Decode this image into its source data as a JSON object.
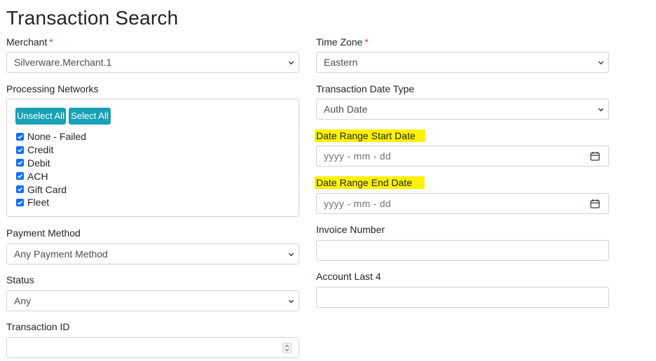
{
  "page": {
    "title": "Transaction Search"
  },
  "left": {
    "merchant": {
      "label": "Merchant",
      "required_mark": "*",
      "value": "Silverware.Merchant.1"
    },
    "processing_networks": {
      "label": "Processing Networks",
      "unselect_all": "Unselect All",
      "select_all": "Select All",
      "items": [
        {
          "label": "None - Failed",
          "checked": true
        },
        {
          "label": "Credit",
          "checked": true
        },
        {
          "label": "Debit",
          "checked": true
        },
        {
          "label": "ACH",
          "checked": true
        },
        {
          "label": "Gift Card",
          "checked": true
        },
        {
          "label": "Fleet",
          "checked": true
        }
      ]
    },
    "payment_method": {
      "label": "Payment Method",
      "value": "Any Payment Method"
    },
    "status": {
      "label": "Status",
      "value": "Any"
    },
    "transaction_id": {
      "label": "Transaction ID",
      "value": ""
    }
  },
  "right": {
    "time_zone": {
      "label": "Time Zone",
      "required_mark": "*",
      "value": "Eastern"
    },
    "transaction_date_type": {
      "label": "Transaction Date Type",
      "value": "Auth Date"
    },
    "date_range_start": {
      "label": "Date Range Start Date",
      "placeholder": "yyyy - mm - dd"
    },
    "date_range_end": {
      "label": "Date Range End Date",
      "placeholder": "yyyy - mm - dd"
    },
    "invoice_number": {
      "label": "Invoice Number",
      "value": ""
    },
    "account_last4": {
      "label": "Account Last 4",
      "value": ""
    }
  },
  "colors": {
    "accent_button": "#17a2b8",
    "checkbox": "#0d6efd",
    "required": "#dc3545",
    "highlight": "#fff200",
    "border": "#ced4da"
  },
  "icons": {
    "select_arrow": "chevron-down-icon",
    "date_picker": "calendar-icon",
    "number_spinner": "spinner-arrows-icon",
    "checkbox": "checkmark-icon"
  }
}
